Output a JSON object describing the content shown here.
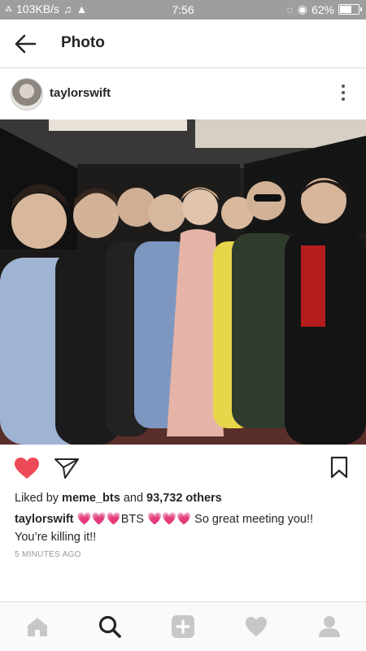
{
  "status_bar": {
    "network_speed": "103KB/s",
    "time": "7:56",
    "battery_percent": "62%",
    "battery_level": 0.62
  },
  "header": {
    "title": "Photo"
  },
  "post": {
    "username": "taylorswift",
    "liked_by_prefix": "Liked by",
    "liked_by_user": "meme_bts",
    "liked_by_and": "and",
    "likes_count": "93,732 others",
    "caption_user": "taylorswift",
    "caption_hearts_1": "💗💗💗",
    "caption_band": "BTS",
    "caption_hearts_2": "💗💗💗",
    "caption_text": "So great meeting you!! You’re killing it!!",
    "time_ago": "5 MINUTES AGO"
  },
  "nav": {
    "items": [
      "home",
      "search",
      "add",
      "activity",
      "profile"
    ]
  },
  "colors": {
    "like_red": "#ed4956",
    "status_bar": "#9e9e9e",
    "hearts_pink": "#ff5ab8"
  }
}
